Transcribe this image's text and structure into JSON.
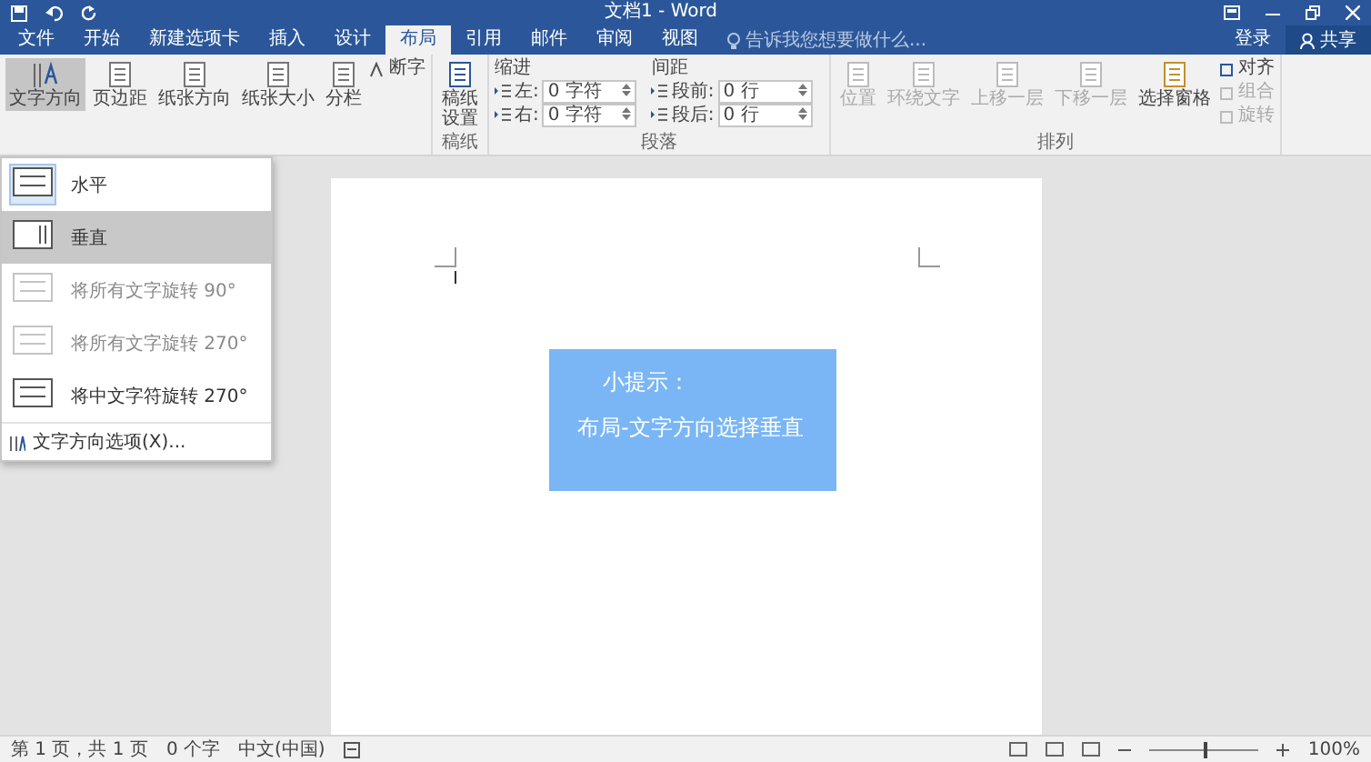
{
  "window": {
    "title": "文档1 - Word"
  },
  "account": {
    "sign_in": "登录",
    "share": "共享"
  },
  "tabs": [
    {
      "label": "文件",
      "selected": false
    },
    {
      "label": "开始",
      "selected": false
    },
    {
      "label": "新建选项卡",
      "selected": false
    },
    {
      "label": "插入",
      "selected": false
    },
    {
      "label": "设计",
      "selected": false
    },
    {
      "label": "布局",
      "selected": true
    },
    {
      "label": "引用",
      "selected": false
    },
    {
      "label": "邮件",
      "selected": false
    },
    {
      "label": "审阅",
      "selected": false
    },
    {
      "label": "视图",
      "selected": false
    }
  ],
  "tell_me": {
    "placeholder": "告诉我您想要做什么..."
  },
  "ribbon": {
    "page_setup": {
      "buttons": [
        {
          "label": "文字方向",
          "selected": true
        },
        {
          "label": "页边距",
          "selected": false
        },
        {
          "label": "纸张方向",
          "selected": false
        },
        {
          "label": "纸张大小",
          "selected": false
        },
        {
          "label": "分栏",
          "selected": false
        }
      ],
      "small_buttons": [
        "断字"
      ]
    },
    "manuscript": {
      "button": "稿纸设置",
      "group": "稿纸"
    },
    "paragraph": {
      "indent": {
        "title": "缩进",
        "left_label": "左:",
        "left": "0 字符",
        "right_label": "右:",
        "right": "0 字符"
      },
      "spacing": {
        "title": "间距",
        "before_label": "段前:",
        "before": "0 行",
        "after_label": "段后:",
        "after": "0 行"
      },
      "group": "段落"
    },
    "arrange": {
      "buttons": [
        {
          "label": "位置",
          "disabled": true
        },
        {
          "label": "环绕文字",
          "disabled": true
        },
        {
          "label": "上移一层",
          "disabled": true
        },
        {
          "label": "下移一层",
          "disabled": true
        },
        {
          "label": "选择窗格",
          "disabled": false
        }
      ],
      "small_buttons": [
        {
          "label": "对齐",
          "disabled": false
        },
        {
          "label": "组合",
          "disabled": true
        },
        {
          "label": "旋转",
          "disabled": true
        }
      ],
      "group": "排列"
    }
  },
  "text_direction_menu": {
    "items": [
      {
        "label": "水平",
        "checked": true,
        "selected": false,
        "disabled": false
      },
      {
        "label": "垂直",
        "checked": false,
        "selected": true,
        "disabled": false
      },
      {
        "label": "将所有文字旋转 90°",
        "checked": false,
        "selected": false,
        "disabled": true
      },
      {
        "label": "将所有文字旋转 270°",
        "checked": false,
        "selected": false,
        "disabled": true
      },
      {
        "label": "将中文字符旋转 270°",
        "checked": false,
        "selected": false,
        "disabled": false
      }
    ],
    "footer": "文字方向选项(X)..."
  },
  "note": {
    "title": "小提示：",
    "text": "布局-文字方向选择垂直"
  },
  "status_bar": {
    "items": [
      "第 1 页，共 1 页",
      "0 个字",
      "中文(中国)"
    ],
    "zoom": {
      "level": 0.5,
      "reading": "100%"
    }
  }
}
